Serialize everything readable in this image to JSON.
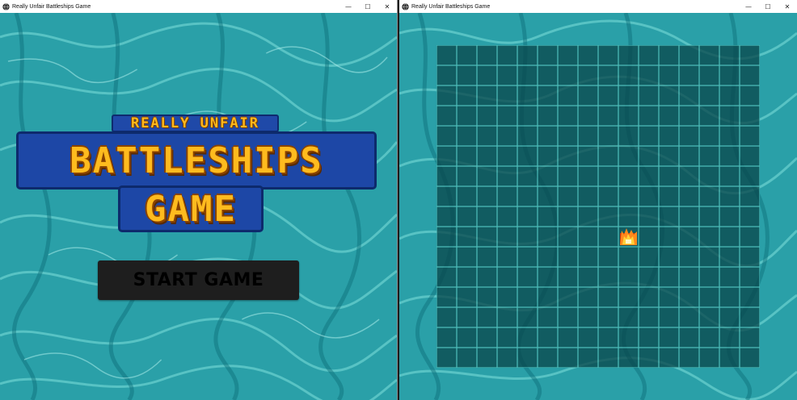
{
  "windows": [
    {
      "id": "left",
      "title": "Really Unfair Battleships Game",
      "controls": {
        "minimize": "—",
        "maximize": "☐",
        "close": "✕"
      },
      "logo": {
        "line1": "REALLY UNFAIR",
        "line2": "BATTLESHIPS",
        "line3": "GAME"
      },
      "start_button": {
        "label": "START GAME"
      }
    },
    {
      "id": "right",
      "title": "Really Unfair Battleships Game",
      "controls": {
        "minimize": "—",
        "maximize": "☐",
        "close": "✕"
      },
      "board": {
        "rows": 16,
        "cols": 16,
        "hits": [
          {
            "row": 9,
            "col": 9
          }
        ]
      }
    }
  ],
  "colors": {
    "water": "#2aa3ab",
    "water_light": "#7fe3e0",
    "grid_cell": "#0b4d52",
    "grid_line": "#53c4c0",
    "logo_blue": "#1d47a6",
    "logo_gold": "#ffbb1e",
    "button": "#1e1e1e"
  },
  "icons": {
    "app": "app-globe-icon",
    "hit": "fire-icon"
  }
}
